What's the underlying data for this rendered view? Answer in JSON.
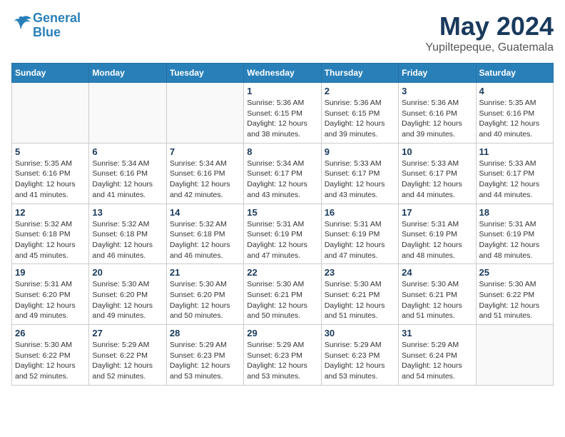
{
  "header": {
    "logo_line1": "General",
    "logo_line2": "Blue",
    "title": "May 2024",
    "location": "Yupiltepeque, Guatemala"
  },
  "weekdays": [
    "Sunday",
    "Monday",
    "Tuesday",
    "Wednesday",
    "Thursday",
    "Friday",
    "Saturday"
  ],
  "weeks": [
    [
      {
        "day": "",
        "sunrise": "",
        "sunset": "",
        "daylight": ""
      },
      {
        "day": "",
        "sunrise": "",
        "sunset": "",
        "daylight": ""
      },
      {
        "day": "",
        "sunrise": "",
        "sunset": "",
        "daylight": ""
      },
      {
        "day": "1",
        "sunrise": "Sunrise: 5:36 AM",
        "sunset": "Sunset: 6:15 PM",
        "daylight": "Daylight: 12 hours and 38 minutes."
      },
      {
        "day": "2",
        "sunrise": "Sunrise: 5:36 AM",
        "sunset": "Sunset: 6:15 PM",
        "daylight": "Daylight: 12 hours and 39 minutes."
      },
      {
        "day": "3",
        "sunrise": "Sunrise: 5:36 AM",
        "sunset": "Sunset: 6:16 PM",
        "daylight": "Daylight: 12 hours and 39 minutes."
      },
      {
        "day": "4",
        "sunrise": "Sunrise: 5:35 AM",
        "sunset": "Sunset: 6:16 PM",
        "daylight": "Daylight: 12 hours and 40 minutes."
      }
    ],
    [
      {
        "day": "5",
        "sunrise": "Sunrise: 5:35 AM",
        "sunset": "Sunset: 6:16 PM",
        "daylight": "Daylight: 12 hours and 41 minutes."
      },
      {
        "day": "6",
        "sunrise": "Sunrise: 5:34 AM",
        "sunset": "Sunset: 6:16 PM",
        "daylight": "Daylight: 12 hours and 41 minutes."
      },
      {
        "day": "7",
        "sunrise": "Sunrise: 5:34 AM",
        "sunset": "Sunset: 6:16 PM",
        "daylight": "Daylight: 12 hours and 42 minutes."
      },
      {
        "day": "8",
        "sunrise": "Sunrise: 5:34 AM",
        "sunset": "Sunset: 6:17 PM",
        "daylight": "Daylight: 12 hours and 43 minutes."
      },
      {
        "day": "9",
        "sunrise": "Sunrise: 5:33 AM",
        "sunset": "Sunset: 6:17 PM",
        "daylight": "Daylight: 12 hours and 43 minutes."
      },
      {
        "day": "10",
        "sunrise": "Sunrise: 5:33 AM",
        "sunset": "Sunset: 6:17 PM",
        "daylight": "Daylight: 12 hours and 44 minutes."
      },
      {
        "day": "11",
        "sunrise": "Sunrise: 5:33 AM",
        "sunset": "Sunset: 6:17 PM",
        "daylight": "Daylight: 12 hours and 44 minutes."
      }
    ],
    [
      {
        "day": "12",
        "sunrise": "Sunrise: 5:32 AM",
        "sunset": "Sunset: 6:18 PM",
        "daylight": "Daylight: 12 hours and 45 minutes."
      },
      {
        "day": "13",
        "sunrise": "Sunrise: 5:32 AM",
        "sunset": "Sunset: 6:18 PM",
        "daylight": "Daylight: 12 hours and 46 minutes."
      },
      {
        "day": "14",
        "sunrise": "Sunrise: 5:32 AM",
        "sunset": "Sunset: 6:18 PM",
        "daylight": "Daylight: 12 hours and 46 minutes."
      },
      {
        "day": "15",
        "sunrise": "Sunrise: 5:31 AM",
        "sunset": "Sunset: 6:19 PM",
        "daylight": "Daylight: 12 hours and 47 minutes."
      },
      {
        "day": "16",
        "sunrise": "Sunrise: 5:31 AM",
        "sunset": "Sunset: 6:19 PM",
        "daylight": "Daylight: 12 hours and 47 minutes."
      },
      {
        "day": "17",
        "sunrise": "Sunrise: 5:31 AM",
        "sunset": "Sunset: 6:19 PM",
        "daylight": "Daylight: 12 hours and 48 minutes."
      },
      {
        "day": "18",
        "sunrise": "Sunrise: 5:31 AM",
        "sunset": "Sunset: 6:19 PM",
        "daylight": "Daylight: 12 hours and 48 minutes."
      }
    ],
    [
      {
        "day": "19",
        "sunrise": "Sunrise: 5:31 AM",
        "sunset": "Sunset: 6:20 PM",
        "daylight": "Daylight: 12 hours and 49 minutes."
      },
      {
        "day": "20",
        "sunrise": "Sunrise: 5:30 AM",
        "sunset": "Sunset: 6:20 PM",
        "daylight": "Daylight: 12 hours and 49 minutes."
      },
      {
        "day": "21",
        "sunrise": "Sunrise: 5:30 AM",
        "sunset": "Sunset: 6:20 PM",
        "daylight": "Daylight: 12 hours and 50 minutes."
      },
      {
        "day": "22",
        "sunrise": "Sunrise: 5:30 AM",
        "sunset": "Sunset: 6:21 PM",
        "daylight": "Daylight: 12 hours and 50 minutes."
      },
      {
        "day": "23",
        "sunrise": "Sunrise: 5:30 AM",
        "sunset": "Sunset: 6:21 PM",
        "daylight": "Daylight: 12 hours and 51 minutes."
      },
      {
        "day": "24",
        "sunrise": "Sunrise: 5:30 AM",
        "sunset": "Sunset: 6:21 PM",
        "daylight": "Daylight: 12 hours and 51 minutes."
      },
      {
        "day": "25",
        "sunrise": "Sunrise: 5:30 AM",
        "sunset": "Sunset: 6:22 PM",
        "daylight": "Daylight: 12 hours and 51 minutes."
      }
    ],
    [
      {
        "day": "26",
        "sunrise": "Sunrise: 5:30 AM",
        "sunset": "Sunset: 6:22 PM",
        "daylight": "Daylight: 12 hours and 52 minutes."
      },
      {
        "day": "27",
        "sunrise": "Sunrise: 5:29 AM",
        "sunset": "Sunset: 6:22 PM",
        "daylight": "Daylight: 12 hours and 52 minutes."
      },
      {
        "day": "28",
        "sunrise": "Sunrise: 5:29 AM",
        "sunset": "Sunset: 6:23 PM",
        "daylight": "Daylight: 12 hours and 53 minutes."
      },
      {
        "day": "29",
        "sunrise": "Sunrise: 5:29 AM",
        "sunset": "Sunset: 6:23 PM",
        "daylight": "Daylight: 12 hours and 53 minutes."
      },
      {
        "day": "30",
        "sunrise": "Sunrise: 5:29 AM",
        "sunset": "Sunset: 6:23 PM",
        "daylight": "Daylight: 12 hours and 53 minutes."
      },
      {
        "day": "31",
        "sunrise": "Sunrise: 5:29 AM",
        "sunset": "Sunset: 6:24 PM",
        "daylight": "Daylight: 12 hours and 54 minutes."
      },
      {
        "day": "",
        "sunrise": "",
        "sunset": "",
        "daylight": ""
      }
    ]
  ]
}
